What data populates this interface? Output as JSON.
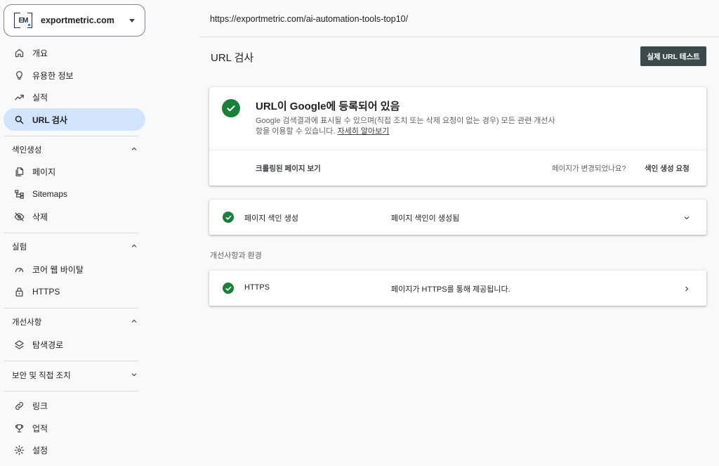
{
  "sidebar": {
    "property": {
      "name": "exportmetric.com",
      "logo_text": "EM"
    },
    "top_items": [
      {
        "label": "개요",
        "icon": "home-icon"
      },
      {
        "label": "유용한 정보",
        "icon": "lightbulb-icon"
      },
      {
        "label": "실적",
        "icon": "trending-up-icon"
      },
      {
        "label": "URL 검사",
        "icon": "search-icon",
        "active": true
      }
    ],
    "sections": [
      {
        "title": "색인생성",
        "expanded": true,
        "items": [
          {
            "label": "페이지",
            "icon": "pages-icon"
          },
          {
            "label": "Sitemaps",
            "icon": "sitemap-icon"
          },
          {
            "label": "삭제",
            "icon": "eye-off-icon"
          }
        ]
      },
      {
        "title": "실험",
        "expanded": true,
        "items": [
          {
            "label": "코어 웹 바이탈",
            "icon": "gauge-icon"
          },
          {
            "label": "HTTPS",
            "icon": "lock-icon"
          }
        ]
      },
      {
        "title": "개선사항",
        "expanded": true,
        "items": [
          {
            "label": "탐색경로",
            "icon": "layers-icon"
          }
        ]
      },
      {
        "title": "보안 및 직접 조치",
        "expanded": false,
        "items": []
      }
    ],
    "bottom_items": [
      {
        "label": "링크",
        "icon": "link-icon"
      },
      {
        "label": "업적",
        "icon": "trophy-icon"
      },
      {
        "label": "설정",
        "icon": "gear-icon"
      }
    ]
  },
  "main": {
    "url": "https://exportmetric.com/ai-automation-tools-top10/",
    "page_title": "URL 검사",
    "live_test_label": "실제 URL 테스트",
    "status": {
      "title": "URL이 Google에 등록되어 있음",
      "desc_line1": "Google 검색결과에 표시될 수 있으며(직접 조치 또는 삭제 요청이 없는 경우) 모든 관련 개선사",
      "desc_line2": "항을 이용할 수 있습니다. ",
      "learn_more": "자세히 알아보기",
      "view_crawled": "크롤링된 페이지 보기",
      "changed_question": "페이지가 변경되었나요?",
      "request_indexing": "색인 생성 요청"
    },
    "indexing_row": {
      "label": "페이지 색인 생성",
      "value": "페이지 색인이 생성됨"
    },
    "enhancements_label": "개선사항과 환경",
    "https_row": {
      "label": "HTTPS",
      "value": "페이지가 HTTPS를 통해 제공됩니다."
    }
  }
}
